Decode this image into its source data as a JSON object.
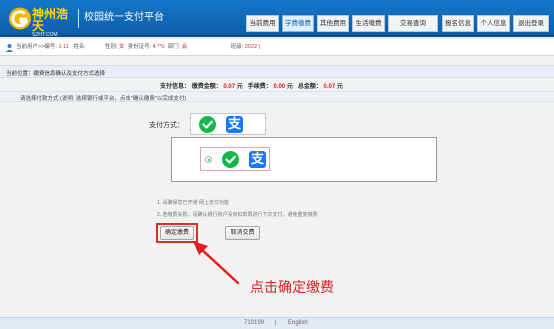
{
  "header": {
    "brand_cn": "神州浩天",
    "brand_en": "SZHT.COM",
    "platform_title": "校园统一支付平台",
    "nav": [
      {
        "label": "当前费用",
        "active": false
      },
      {
        "label": "学费缴费",
        "active": true
      },
      {
        "label": "其他费用",
        "active": false
      },
      {
        "label": "生活缴费",
        "active": false
      },
      {
        "label": "交易查询",
        "active": false
      },
      {
        "label": "报名信息",
        "active": false
      },
      {
        "label": "个人信息",
        "active": false
      },
      {
        "label": "退出登录",
        "active": false
      }
    ]
  },
  "userbar": {
    "prefix": "当前用户>>编号:",
    "id_value": "1          11",
    "name_label": "姓名:",
    "name_value": "",
    "gender_label": "性别:",
    "gender_value": "女",
    "idcard_label": "身份证号:",
    "idcard_value": "4                         **0",
    "dept_label": "部门:",
    "dept_value": "会",
    "class_label": "班级:",
    "class_value": "2022                                    )"
  },
  "breadcrumb": "当前位置：缴费信息确认及支付方式选择",
  "summary": {
    "payinfo_label": "支付信息：",
    "amount_label": "缴费金额：",
    "amount_value": "0.07",
    "fee_label": "手续费：",
    "fee_value": "0.00",
    "total_label": "总金额：",
    "total_value": "0.07",
    "unit": "元"
  },
  "method_note": "请选择付款方式 (说明: 选择银行或平台，点击\"确认缴费\"以完成支付)",
  "payment": {
    "label": "支付方式：",
    "alipay_glyph": "支",
    "icons": [
      "wechat-pay-icon",
      "alipay-icon"
    ]
  },
  "notes": [
    "1. 请确保您已开通 网上支付功能",
    "2. 若缴费失败，请确认银行账户没有扣款再进行下次支付，避免重复缴费"
  ],
  "buttons": {
    "confirm": "确定缴费",
    "cancel": "取消交费"
  },
  "annotation": "点击确定缴费",
  "footer": {
    "code": "710199",
    "separator": "|",
    "lang": "English"
  },
  "colors": {
    "header_blue": "#1577c8",
    "brand_yellow": "#ffd800",
    "accent_red": "#e21f1f",
    "wechat_green": "#16b84a",
    "alipay_blue": "#1677ff"
  }
}
